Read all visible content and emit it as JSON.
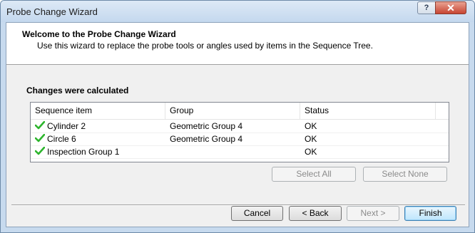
{
  "window": {
    "title": "Probe Change Wizard",
    "help_label": "?",
    "close_label": "✕"
  },
  "header": {
    "title": "Welcome to the Probe Change Wizard",
    "description": "Use this wizard to replace the probe tools or angles used by items in the Sequence Tree."
  },
  "section": {
    "title": "Changes were calculated"
  },
  "list": {
    "columns": [
      "Sequence item",
      "Group",
      "Status"
    ],
    "rows": [
      {
        "icon": "checkmark-icon",
        "item": "Cylinder 2",
        "group": "Geometric Group 4",
        "status": "OK"
      },
      {
        "icon": "checkmark-icon",
        "item": "Circle 6",
        "group": "Geometric Group 4",
        "status": "OK"
      },
      {
        "icon": "checkmark-icon",
        "item": "Inspection Group 1",
        "group": "",
        "status": "OK"
      }
    ]
  },
  "selection_buttons": {
    "select_all": "Select All",
    "select_none": "Select None"
  },
  "footer": {
    "cancel": "Cancel",
    "back": "< Back",
    "next": "Next >",
    "finish": "Finish"
  },
  "colors": {
    "check": "#2db52d",
    "accent": "#3c7fb1"
  }
}
